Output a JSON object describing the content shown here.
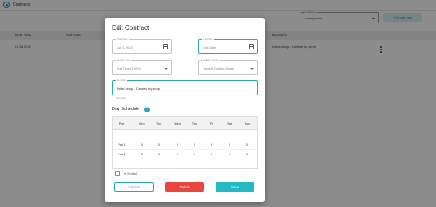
{
  "app": {
    "title": "Contracts"
  },
  "background": {
    "select": {
      "label": "Employee",
      "value": "Anonymous"
    },
    "create_button": "+ Create new",
    "table": {
      "headers": [
        "Start Date",
        "End Date",
        "Remarks"
      ],
      "row": {
        "start_date": "01.06.2022",
        "remarks": "Initial setup - Created by script"
      }
    }
  },
  "dialog": {
    "title": "Edit Contract",
    "start_date": {
      "label": "Start Date",
      "value": "Jun 1 2022"
    },
    "end_date": {
      "label": "End Date",
      "value": "End Date"
    },
    "project_type": {
      "label": "Project Type",
      "value": "Full Time (100%)"
    },
    "holiday_model": {
      "label": "Holiday Model",
      "value": "Default Holiday Model"
    },
    "remarks": {
      "label": "Remarks",
      "value": "Initial setup - Created by script"
    },
    "helper_text": "Remarks",
    "day_schedule": {
      "title": "Day Schedule",
      "help_glyph": "?",
      "headers": [
        "Part",
        "Mon",
        "Tue",
        "Wed",
        "Thu",
        "Fri",
        "Sat",
        "Sun"
      ],
      "rows": [
        [
          "Part 1",
          "0",
          "0",
          "0",
          "0",
          "0",
          "0",
          "0"
        ],
        [
          "Part 2",
          "0",
          "0",
          "0",
          "0",
          "0",
          "0",
          "0"
        ]
      ]
    },
    "checkbox_label": "Is Settled",
    "buttons": {
      "cancel": "Cancel",
      "delete": "Delete",
      "save": "Save"
    }
  }
}
